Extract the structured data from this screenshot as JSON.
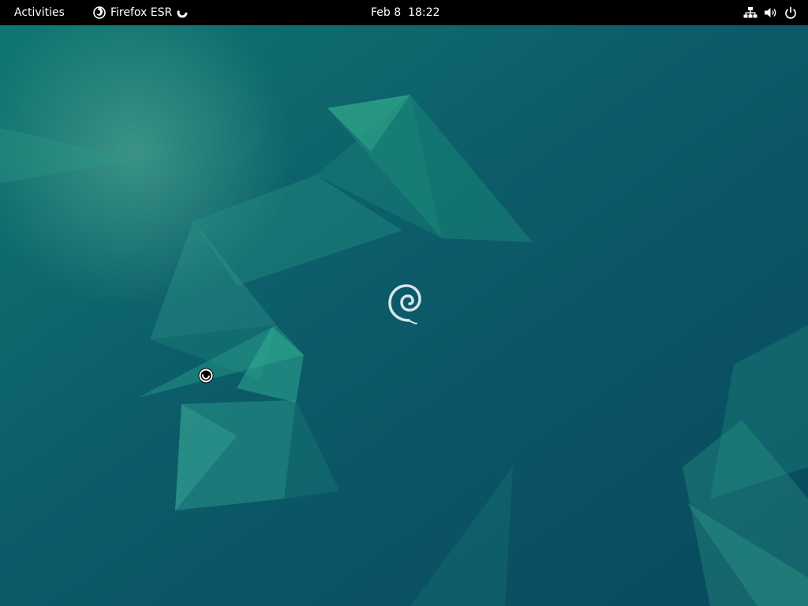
{
  "topbar": {
    "activities_label": "Activities",
    "app_name": "Firefox ESR",
    "app_icon": "firefox-icon",
    "loading_indicator": "spinner-icon",
    "date": "Feb 8",
    "time": "18:22",
    "status_icons": [
      "network-wired-icon",
      "volume-icon",
      "power-icon"
    ]
  },
  "desktop": {
    "wallpaper": "debian-12-bookworm-wallpaper",
    "logo": "debian-swirl-icon",
    "cursor": "busy-cursor-icon"
  },
  "colors": {
    "topbar_bg": "#000000",
    "topbar_text": "#ffffff",
    "wallpaper_base": "#0b5566",
    "wallpaper_accent": "#1a8f7a"
  }
}
